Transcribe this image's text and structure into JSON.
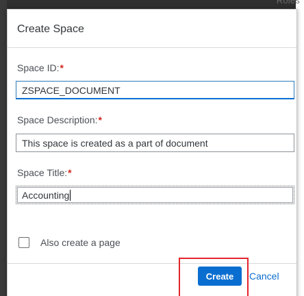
{
  "background": {
    "fragment_text": "Roles"
  },
  "dialog": {
    "title": "Create Space",
    "fields": [
      {
        "label": "Space ID:",
        "required_mark": "*",
        "value": "ZSPACE_DOCUMENT"
      },
      {
        "label": "Space Description:",
        "required_mark": "*",
        "value": "This space is created as a part of document"
      },
      {
        "label": "Space Title:",
        "required_mark": "*",
        "value": "Accounting"
      }
    ],
    "checkbox": {
      "label": "Also create a page",
      "checked": false
    },
    "buttons": {
      "create_label": "Create",
      "cancel_label": "Cancel"
    }
  },
  "colors": {
    "accent": "#0a6ed1",
    "required": "#d0271d",
    "highlight": "#e3232a"
  }
}
